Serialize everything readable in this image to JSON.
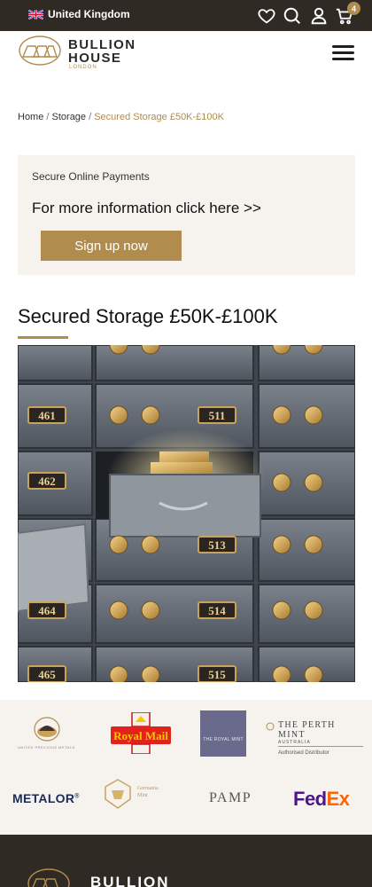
{
  "topbar": {
    "region": "United Kingdom",
    "cart_count": "4"
  },
  "header": {
    "logo_line1": "BULLION",
    "logo_line2": "HOUSE",
    "logo_sub": "LONDON"
  },
  "breadcrumb": {
    "home": "Home",
    "sep1": " / ",
    "storage": "Storage",
    "sep2": " / ",
    "current": "Secured Storage £50K-£100K"
  },
  "promo": {
    "subtitle": "Secure Online Payments",
    "info": "For more information click here >>",
    "button": "Sign up now"
  },
  "page": {
    "title": "Secured Storage £50K-£100K"
  },
  "hero": {
    "box_numbers": [
      "461",
      "511",
      "462",
      "513",
      "464",
      "514",
      "465",
      "515"
    ]
  },
  "partners": {
    "metalor": "METALOR",
    "metalor_reg": "®",
    "pamp": "PAMP",
    "fedex_fed": "Fed",
    "fedex_ex": "Ex",
    "royal_mail": "Royal Mail",
    "royal_mint": "THE ROYAL MINT",
    "perth_title": "THE PERTH MINT",
    "perth_country": "AUSTRALIA",
    "perth_dist": "Authorised Distributor",
    "germania_line1": "Germania",
    "germania_line2": "Mint",
    "united_pm": "UNITED PRECIOUS METALS"
  },
  "footer": {
    "name": "BULLION"
  },
  "colors": {
    "gold": "#b08d4f",
    "dark": "#2f2a24",
    "cream": "#f6f3ef"
  },
  "icons": [
    "uk-flag-icon",
    "heart-icon",
    "search-icon",
    "user-icon",
    "cart-icon",
    "menu-icon"
  ]
}
